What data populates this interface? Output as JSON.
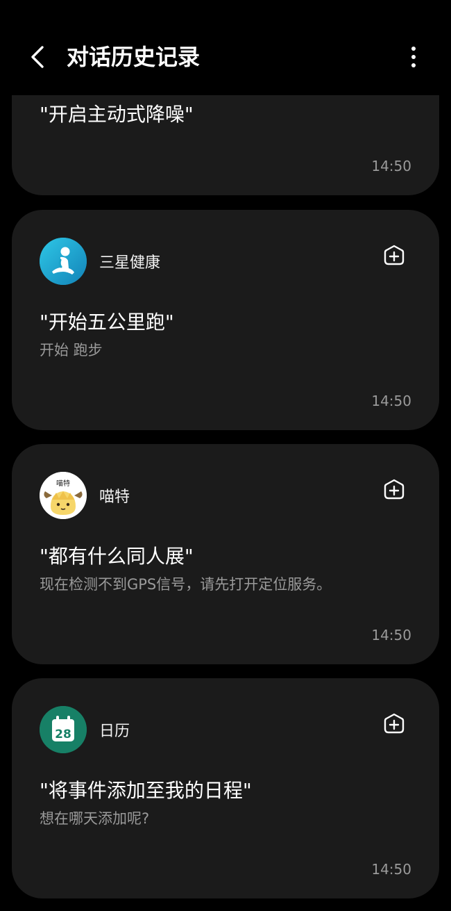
{
  "header": {
    "title": "对话历史记录",
    "back_icon": "chevron-left-icon",
    "more_icon": "more-vertical-icon"
  },
  "history": [
    {
      "query": "\"开启主动式降噪\"",
      "time": "14:50"
    },
    {
      "app": "三星健康",
      "app_icon": "samsung-health-icon",
      "app_color": "#1aa3c9",
      "query": "\"开始五公里跑\"",
      "response": "开始 跑步",
      "time": "14:50"
    },
    {
      "app": "喵特",
      "app_icon": "miaote-avatar-icon",
      "avatar_text": "喵特",
      "query": "\"都有什么同人展\"",
      "response": "现在检测不到GPS信号，请先打开定位服务。",
      "time": "14:50"
    },
    {
      "app": "日历",
      "app_icon": "calendar-icon",
      "app_color": "#178066",
      "calendar_day": "28",
      "query": "\"将事件添加至我的日程\"",
      "response": "想在哪天添加呢?",
      "time": "14:50"
    }
  ],
  "colors": {
    "background": "#000000",
    "card": "#1b1b1b",
    "secondary_text": "#9a9a9a"
  }
}
